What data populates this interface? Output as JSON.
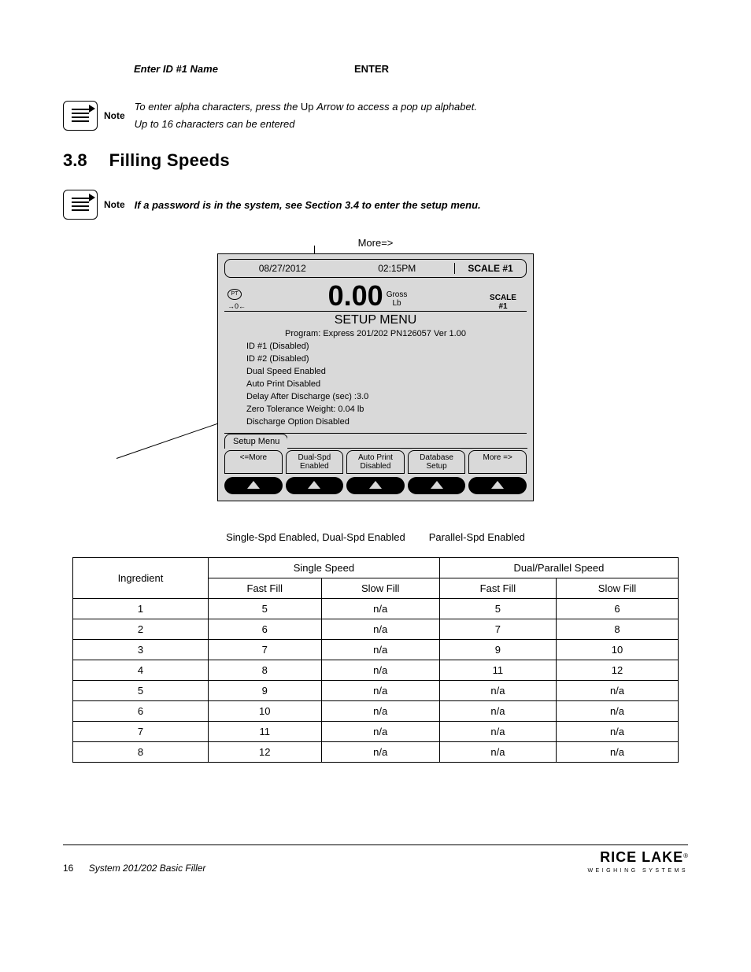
{
  "top_line": {
    "left": "Enter ID #1 Name",
    "right": "ENTER"
  },
  "note1": {
    "label": "Note",
    "line1_a": "To enter alpha characters, press the ",
    "line1_b": "Up ",
    "line1_c": "Arrow to access a pop up alphabet.",
    "line2": "Up to 16 characters can be entered"
  },
  "section": {
    "num": "3.8",
    "title": "Filling Speeds"
  },
  "note2": {
    "label": "Note",
    "text": "If a password is in the system, see Section 3.4 to enter the setup menu."
  },
  "more_label": "More=>",
  "device": {
    "date": "08/27/2012",
    "time": "02:15PM",
    "scale_header": "SCALE #1",
    "weight": "0.00",
    "weight_unit1": "Gross",
    "weight_unit2": "Lb",
    "scale_side1": "SCALE",
    "scale_side2": "#1",
    "icon1": "PT",
    "icon2": "→0←",
    "title": "SETUP MENU",
    "program": "Program: Express 201/202 PN126057 Ver 1.00",
    "lines": [
      "ID #1 (Disabled)",
      "ID #2 (Disabled)",
      "Dual Speed Enabled",
      "Auto Print Disabled",
      "Delay After Discharge (sec) :3.0",
      "Zero Tolerance Weight: 0.04 lb",
      "Discharge Option Disabled"
    ],
    "tab": "Setup Menu",
    "funcs": [
      "<=More",
      "Dual-Spd\nEnabled",
      "Auto Print\nDisabled",
      "Database\nSetup",
      "More =>"
    ]
  },
  "caption": {
    "left": "Single-Spd Enabled, Dual-Spd Enabled",
    "right": "Parallel-Spd Enabled"
  },
  "table": {
    "col_group1": "Single Speed",
    "col_group2": "Dual/Parallel Speed",
    "row_headers": [
      "Ingredient",
      "Fast Fill",
      "Slow Fill",
      "Fast Fill",
      "Slow Fill"
    ],
    "rows": [
      [
        "1",
        "5",
        "n/a",
        "5",
        "6"
      ],
      [
        "2",
        "6",
        "n/a",
        "7",
        "8"
      ],
      [
        "3",
        "7",
        "n/a",
        "9",
        "10"
      ],
      [
        "4",
        "8",
        "n/a",
        "11",
        "12"
      ],
      [
        "5",
        "9",
        "n/a",
        "n/a",
        "n/a"
      ],
      [
        "6",
        "10",
        "n/a",
        "n/a",
        "n/a"
      ],
      [
        "7",
        "11",
        "n/a",
        "n/a",
        "n/a"
      ],
      [
        "8",
        "12",
        "n/a",
        "n/a",
        "n/a"
      ]
    ]
  },
  "footer": {
    "page": "16",
    "doc": "System 201/202 Basic Filler",
    "logo_main": "RICE LAKE",
    "logo_sub": "WEIGHING SYSTEMS",
    "reg": "®"
  }
}
